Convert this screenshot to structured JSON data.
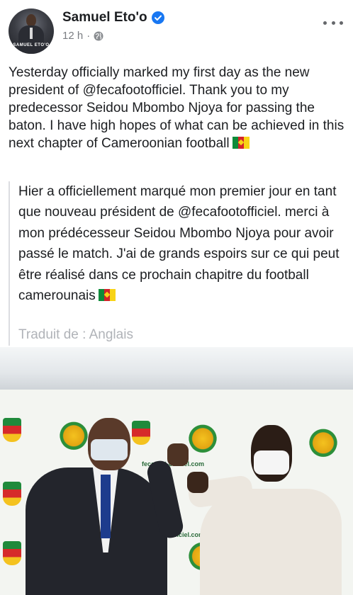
{
  "post": {
    "author": "Samuel Eto'o",
    "verified_icon": "verified-badge-icon",
    "timestamp": "12 h",
    "separator": "·",
    "audience_icon": "globe-icon",
    "more_icon": "more-options-icon",
    "avatar_caption": "SAMUEL ETO'O",
    "text": "Yesterday officially marked my first day as the new president of @fecafootofficiel. Thank you to my predecessor Seidou Mbombo Njoya for passing the baton. I have high hopes of what can be achieved in this next chapter of Cameroonian football",
    "translation": {
      "text": "Hier a officiellement marqué mon premier jour en tant que nouveau président de @fecafootofficiel. merci à mon prédécesseur Seidou Mbombo Njoya pour avoir passé le match. J'ai de grands espoirs sur ce qui peut être réalisé dans ce prochain chapitre du football camerounais",
      "source_label": "Traduit de : Anglais"
    },
    "photo": {
      "backdrop_site_text": "fecafoot-officiel.com",
      "flag_colors": [
        "#0e8b3a",
        "#d3232a",
        "#f8d316"
      ]
    }
  },
  "colors": {
    "verified_blue": "#1877f2",
    "secondary_text": "#7a7d82",
    "muted_text": "#b0b3b8"
  }
}
